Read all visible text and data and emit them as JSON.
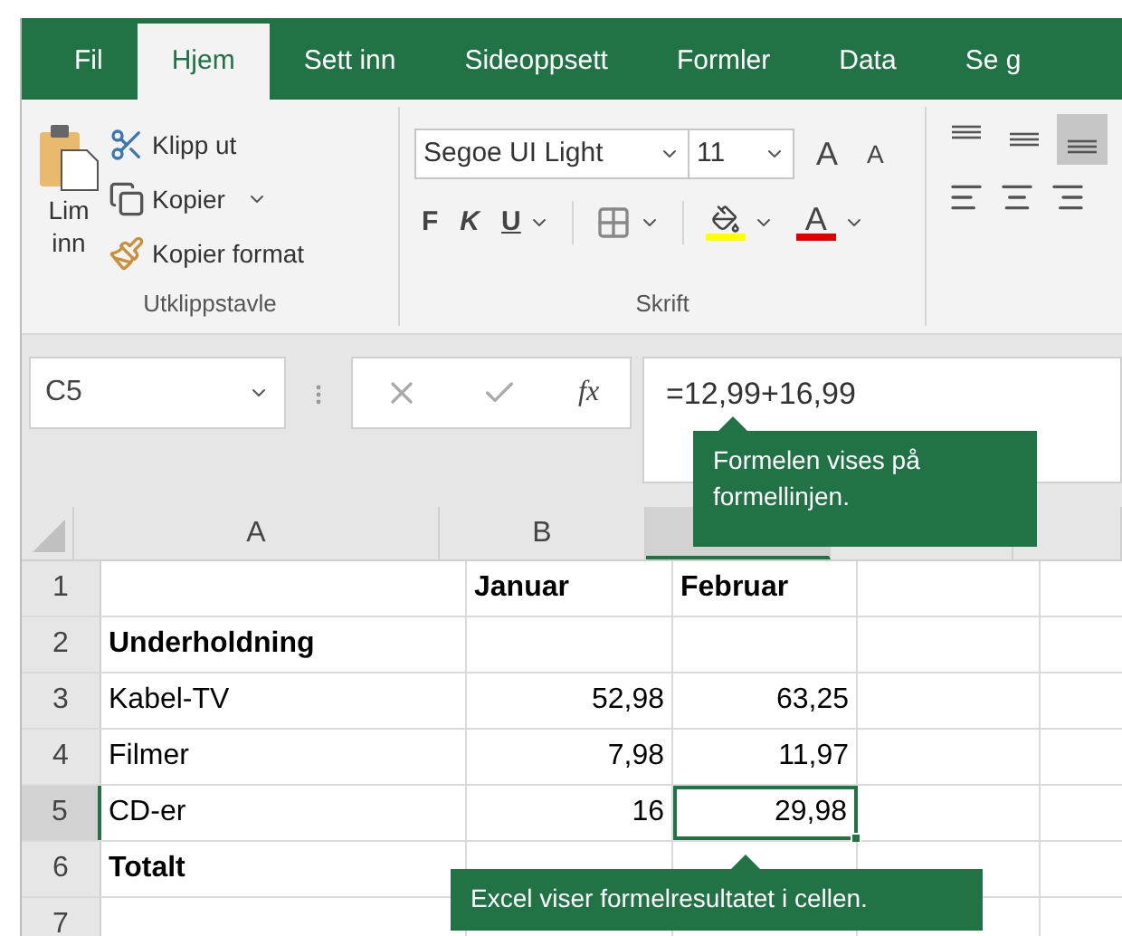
{
  "tabs": [
    {
      "label": "Fil",
      "selected": false
    },
    {
      "label": "Hjem",
      "selected": true
    },
    {
      "label": "Sett inn",
      "selected": false
    },
    {
      "label": "Sideoppsett",
      "selected": false
    },
    {
      "label": "Formler",
      "selected": false
    },
    {
      "label": "Data",
      "selected": false
    },
    {
      "label": "Se g",
      "selected": false
    }
  ],
  "clipboard": {
    "paste": "Lim inn",
    "cut": "Klipp ut",
    "copy": "Kopier",
    "format_painter": "Kopier format",
    "group_label": "Utklippstavle"
  },
  "font": {
    "font_name": "Segoe UI Light",
    "font_size": "11",
    "grow": "A",
    "shrink": "A",
    "bold": "F",
    "italic": "K",
    "underline": "U",
    "font_color": "A",
    "group_label": "Skrift"
  },
  "alignment": {
    "vertical": [
      {
        "kind": "top",
        "selected": false
      },
      {
        "kind": "middle",
        "selected": false
      },
      {
        "kind": "bottom",
        "selected": true
      }
    ]
  },
  "formula_bar": {
    "name_box": "C5",
    "function_label": "fx",
    "formula": "=12,99+16,99"
  },
  "column_headers": [
    {
      "label": "A",
      "selected": false
    },
    {
      "label": "B",
      "selected": false
    },
    {
      "selected": true
    },
    {
      "selected": false
    },
    {
      "selected": false
    }
  ],
  "rows": [
    {
      "number": "1",
      "selected": false,
      "cells": [
        {
          "kind": "empty"
        },
        {
          "kind": "text",
          "text": "Januar",
          "bold": true
        },
        {
          "kind": "text",
          "text": "Februar",
          "bold": true
        }
      ]
    },
    {
      "number": "2",
      "selected": false,
      "cells": [
        {
          "kind": "text",
          "text": "Underholdning",
          "bold": true
        },
        {
          "kind": "empty"
        },
        {
          "kind": "empty"
        }
      ]
    },
    {
      "number": "3",
      "selected": false,
      "cells": [
        {
          "kind": "text",
          "text": "Kabel-TV",
          "bold": false
        },
        {
          "kind": "number",
          "text": "52,98",
          "bold": false
        },
        {
          "kind": "number",
          "text": "63,25",
          "bold": false
        }
      ]
    },
    {
      "number": "4",
      "selected": false,
      "cells": [
        {
          "kind": "text",
          "text": "Filmer",
          "bold": false
        },
        {
          "kind": "number",
          "text": "7,98",
          "bold": false
        },
        {
          "kind": "number",
          "text": "11,97",
          "bold": false
        }
      ]
    },
    {
      "number": "5",
      "selected": true,
      "cells": [
        {
          "kind": "text",
          "text": "CD-er",
          "bold": false
        },
        {
          "kind": "number",
          "text": "16",
          "bold": false
        },
        {
          "kind": "number",
          "text": "29,98",
          "bold": false,
          "selected": true
        }
      ]
    },
    {
      "number": "6",
      "selected": false,
      "cells": [
        {
          "kind": "text",
          "text": "Totalt",
          "bold": true
        },
        {
          "kind": "empty"
        },
        {
          "kind": "empty"
        }
      ]
    },
    {
      "number": "7",
      "selected": false,
      "cells": [
        {
          "kind": "empty"
        },
        {
          "kind": "empty"
        },
        {
          "kind": "empty"
        }
      ]
    }
  ],
  "callouts": [
    {
      "kind": "formula",
      "text": "Formelen vises på formellinjen."
    },
    {
      "kind": "cell",
      "text": "Excel viser formelresultatet i cellen."
    }
  ]
}
